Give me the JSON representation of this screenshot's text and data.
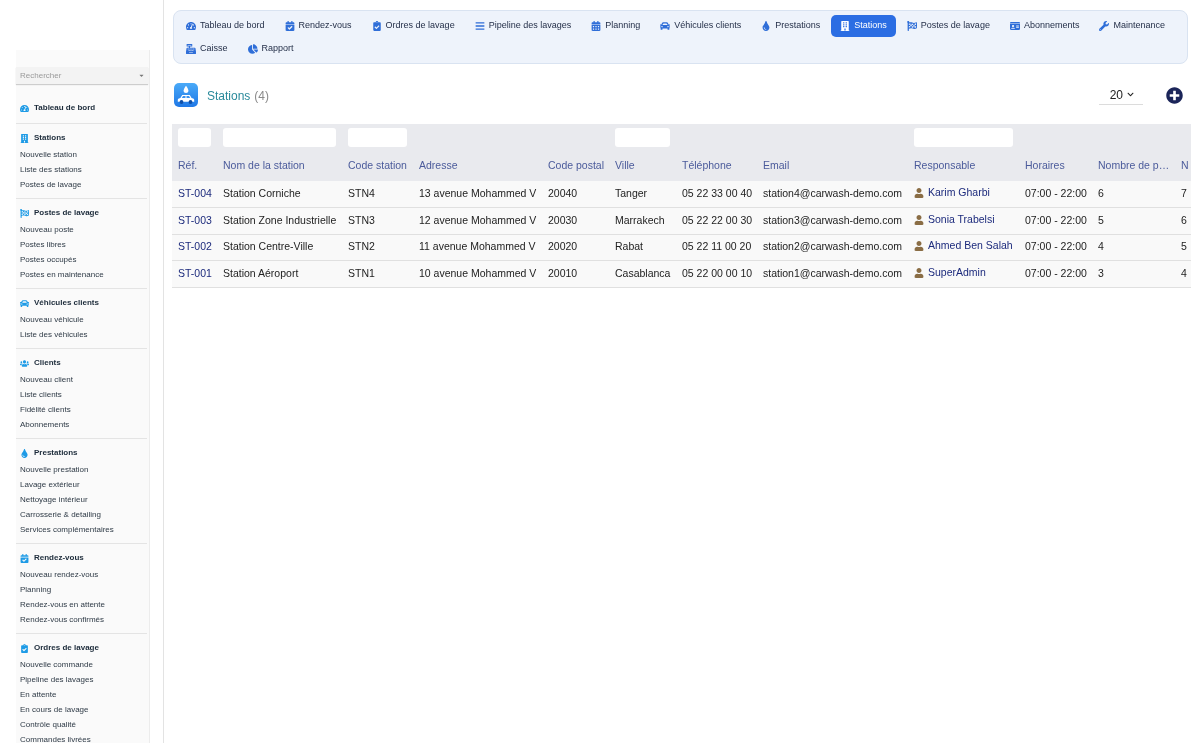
{
  "nav": {
    "tabs": [
      {
        "label": "Tableau de bord",
        "selected": false
      },
      {
        "label": "Rendez-vous",
        "selected": false
      },
      {
        "label": "Ordres de lavage",
        "selected": false
      },
      {
        "label": "Pipeline des lavages",
        "selected": false
      },
      {
        "label": "Planning",
        "selected": false
      },
      {
        "label": "Véhicules clients",
        "selected": false
      },
      {
        "label": "Prestations",
        "selected": false
      },
      {
        "label": "Stations",
        "selected": true
      },
      {
        "label": "Postes de lavage",
        "selected": false
      },
      {
        "label": "Abonnements",
        "selected": false
      },
      {
        "label": "Maintenance",
        "selected": false
      },
      {
        "label": "Caisse",
        "selected": false
      },
      {
        "label": "Rapport",
        "selected": false
      }
    ]
  },
  "sidebar": {
    "search": {
      "placeholder": "Rechercher"
    },
    "sections": [
      {
        "title": "Tableau de bord"
      },
      {
        "title": "Stations",
        "items": [
          "Nouvelle station",
          "Liste des stations",
          "Postes de lavage"
        ]
      },
      {
        "title": "Postes de lavage",
        "items": [
          "Nouveau poste",
          "Postes libres",
          "Postes occupés",
          "Postes en maintenance"
        ]
      },
      {
        "title": "Véhicules clients",
        "items": [
          "Nouveau véhicule",
          "Liste des véhicules"
        ]
      },
      {
        "title": "Clients",
        "items": [
          "Nouveau client",
          "Liste clients",
          "Fidélité clients",
          "Abonnements"
        ]
      },
      {
        "title": "Prestations",
        "items": [
          "Nouvelle prestation",
          "Lavage extérieur",
          "Nettoyage intérieur",
          "Carrosserie & detailing",
          "Services complémentaires"
        ]
      },
      {
        "title": "Rendez-vous",
        "items": [
          "Nouveau rendez-vous",
          "Planning",
          "Rendez-vous en attente",
          "Rendez-vous confirmés"
        ]
      },
      {
        "title": "Ordres de lavage",
        "items": [
          "Nouvelle commande",
          "Pipeline des lavages",
          "En attente",
          "En cours de lavage",
          "Contrôle qualité",
          "Commandes livrées"
        ]
      }
    ]
  },
  "page_header": {
    "title": "Stations",
    "count": "(4)",
    "page_size": "20"
  },
  "table": {
    "columns": [
      {
        "label": "Réf.",
        "kind": "link",
        "filter": true
      },
      {
        "label": "Nom de la station",
        "kind": "text",
        "filter": true
      },
      {
        "label": "Code station",
        "kind": "text",
        "filter": true
      },
      {
        "label": "Adresse",
        "kind": "text",
        "filter": false
      },
      {
        "label": "Code postal",
        "kind": "text",
        "filter": false
      },
      {
        "label": "Ville",
        "kind": "text",
        "filter": true
      },
      {
        "label": "Téléphone",
        "kind": "text",
        "filter": false
      },
      {
        "label": "Email",
        "kind": "text",
        "filter": false
      },
      {
        "label": "Responsable",
        "kind": "person",
        "filter": true
      },
      {
        "label": "Horaires",
        "kind": "text",
        "filter": false
      },
      {
        "label": "Nombre de p…",
        "kind": "text",
        "filter": false
      },
      {
        "label": "N",
        "kind": "text",
        "filter": false
      }
    ],
    "rows": [
      {
        "cells": [
          "ST-004",
          "Station Corniche",
          "STN4",
          "13 avenue Mohammed V",
          "20040",
          "Tanger",
          "05 22 33 00 40",
          "station4@carwash-demo.com",
          "Karim Gharbi",
          "07:00 - 22:00",
          "6",
          "7"
        ]
      },
      {
        "cells": [
          "ST-003",
          "Station Zone Industrielle",
          "STN3",
          "12 avenue Mohammed V",
          "20030",
          "Marrakech",
          "05 22 22 00 30",
          "station3@carwash-demo.com",
          "Sonia Trabelsi",
          "07:00 - 22:00",
          "5",
          "6"
        ]
      },
      {
        "cells": [
          "ST-002",
          "Station Centre-Ville",
          "STN2",
          "11 avenue Mohammed V",
          "20020",
          "Rabat",
          "05 22 11 00 20",
          "station2@carwash-demo.com",
          "Ahmed Ben Salah",
          "07:00 - 22:00",
          "4",
          "5"
        ]
      },
      {
        "cells": [
          "ST-001",
          "Station Aéroport",
          "STN1",
          "10 avenue Mohammed V",
          "20010",
          "Casablanca",
          "05 22 00 00 10",
          "station1@carwash-demo.com",
          "SuperAdmin",
          "07:00 - 22:00",
          "3",
          "4"
        ]
      }
    ]
  }
}
